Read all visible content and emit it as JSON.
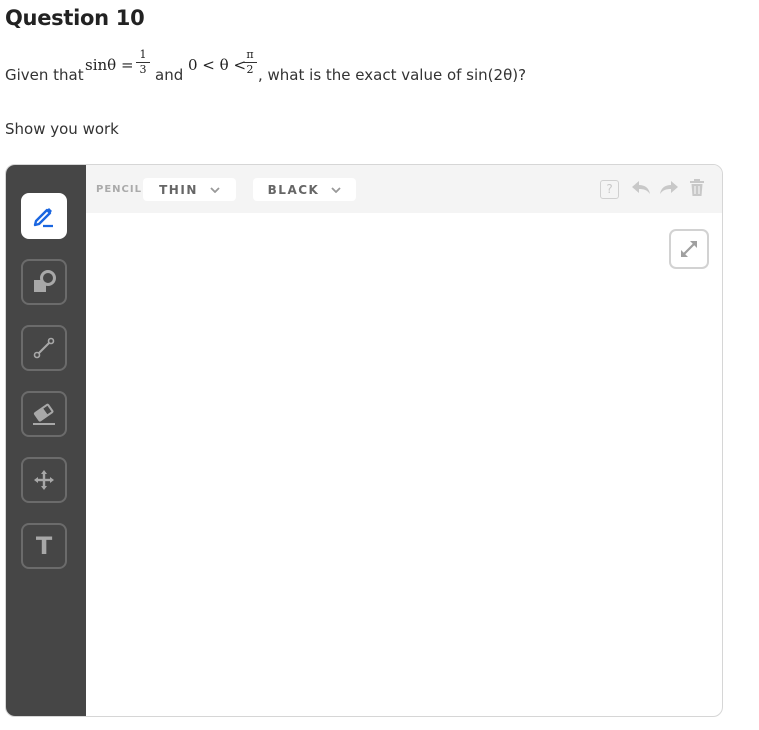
{
  "question": {
    "title": "Question 10",
    "prefix": "Given that",
    "expr1_lhs": "sinθ =",
    "expr1_num": "1",
    "expr1_den": "3",
    "and": "and",
    "expr2_lhs": "0 < θ <",
    "expr2_num": "π",
    "expr2_den": "2",
    "suffix": ", what is the exact value of sin(2θ)?",
    "instruction": "Show you work"
  },
  "toolbar": {
    "tool_label": "PENCIL",
    "thickness": "THIN",
    "color": "BLACK",
    "help": "?",
    "icons": [
      "help-icon",
      "undo-icon",
      "redo-icon",
      "trash-icon",
      "expand-icon"
    ]
  },
  "sidebar": {
    "tools": [
      {
        "name": "pencil",
        "active": true
      },
      {
        "name": "shapes",
        "active": false
      },
      {
        "name": "line",
        "active": false
      },
      {
        "name": "eraser",
        "active": false
      },
      {
        "name": "move",
        "active": false
      },
      {
        "name": "text",
        "active": false,
        "glyph": "T"
      }
    ]
  },
  "colors": {
    "accent": "#1a66e0",
    "sidebar_bg": "#464646",
    "toolbar_bg": "#f4f4f4",
    "icon_gray": "#b0b0b0"
  }
}
